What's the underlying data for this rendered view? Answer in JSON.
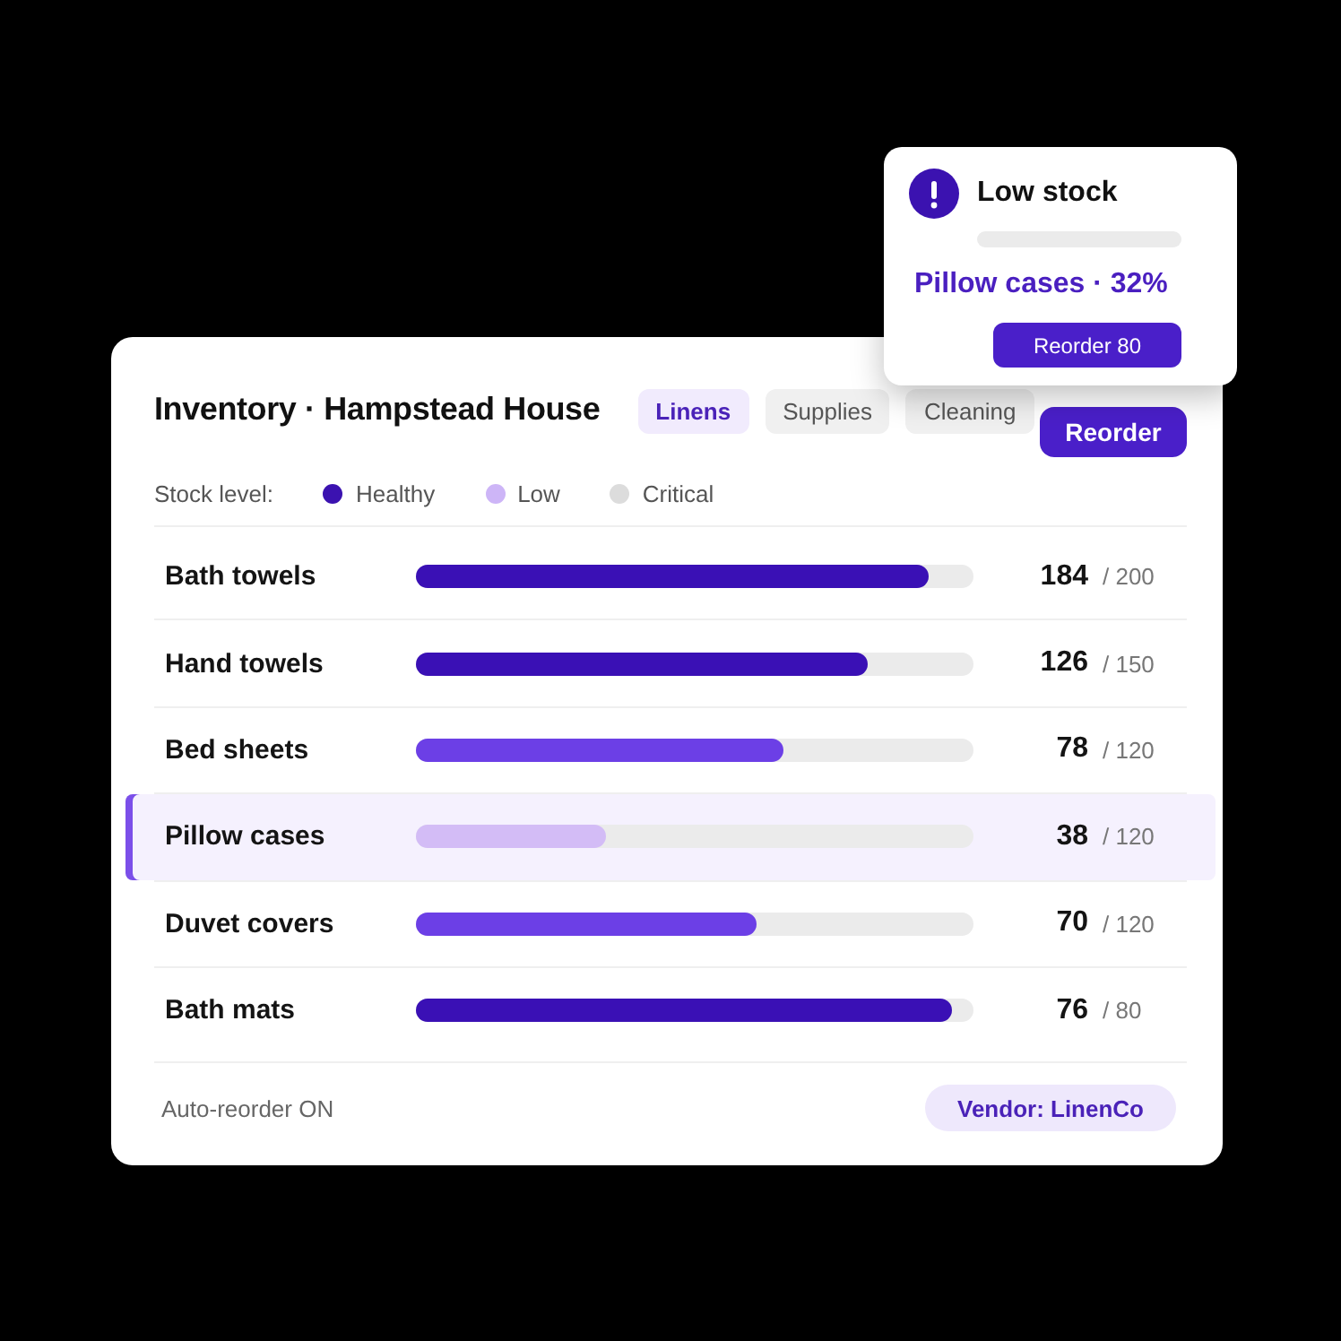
{
  "alert": {
    "title": "Low stock",
    "message": "Pillow cases · 32%",
    "button": "Reorder 80"
  },
  "panel": {
    "title": "Inventory · Hampstead House",
    "tabs": [
      {
        "label": "Linens",
        "selected": true
      },
      {
        "label": "Supplies",
        "selected": false
      },
      {
        "label": "Cleaning",
        "selected": false
      }
    ],
    "primary_button": "Reorder",
    "legend": {
      "label": "Stock level:",
      "items": [
        {
          "label": "Healthy",
          "color": "#3b12b0"
        },
        {
          "label": "Low",
          "color": "#cdb5f7"
        },
        {
          "label": "Critical",
          "color": "#dcdcdc"
        }
      ]
    },
    "rows": [
      {
        "name": "Bath towels",
        "level": 0.92,
        "color": "#3a10b5",
        "count": "184",
        "capacity": "/ 200",
        "selected": false
      },
      {
        "name": "Hand towels",
        "level": 0.81,
        "color": "#3a10b5",
        "count": "126",
        "capacity": "/ 150",
        "selected": false
      },
      {
        "name": "Bed sheets",
        "level": 0.66,
        "color": "#6c3fe6",
        "count": "78",
        "capacity": "/ 120",
        "selected": false
      },
      {
        "name": "Pillow cases",
        "level": 0.34,
        "color": "#d3bcf6",
        "count": "38",
        "capacity": "/ 120",
        "selected": true
      },
      {
        "name": "Duvet covers",
        "level": 0.61,
        "color": "#6c3fe6",
        "count": "70",
        "capacity": "/ 120",
        "selected": false
      },
      {
        "name": "Bath mats",
        "level": 0.96,
        "color": "#3a10b5",
        "count": "76",
        "capacity": "/ 80",
        "selected": false
      }
    ],
    "footer": {
      "status": "Auto-reorder ON",
      "vendor": "Vendor: LinenCo"
    }
  }
}
